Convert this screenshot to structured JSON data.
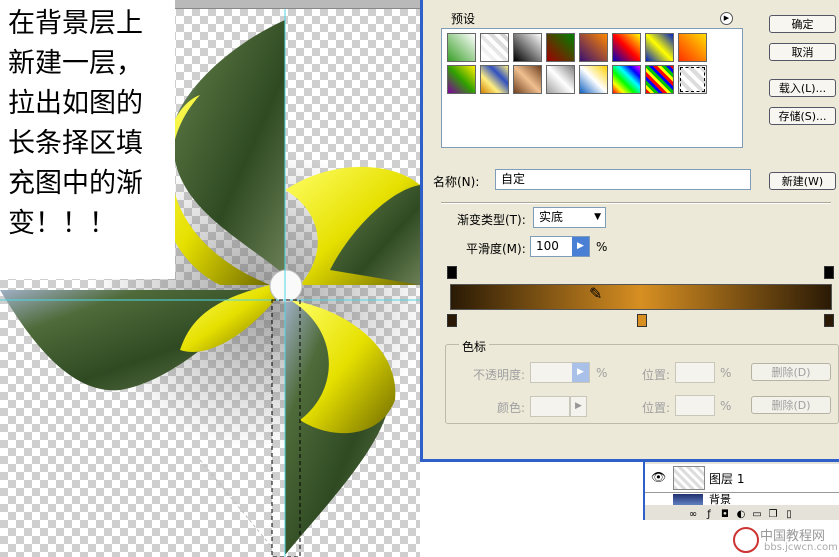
{
  "note": {
    "lines": [
      "在背景层上",
      "新建一层，",
      "拉出如图的",
      "长条择区填",
      "充图中的渐",
      "变！！！"
    ]
  },
  "dialog": {
    "presets_label": "预设",
    "buttons": {
      "ok": "确定",
      "cancel": "取消",
      "load": "载入(L)...",
      "save": "存储(S)...",
      "new": "新建(W)"
    },
    "name_label": "名称(N):",
    "name_value": "自定",
    "gradient_type_label": "渐变类型(T):",
    "gradient_type_value": "实底",
    "smoothness_label": "平滑度(M):",
    "smoothness_value": "100",
    "percent": "%",
    "stops_group_label": "色标",
    "opacity_label": "不透明度:",
    "color_label": "颜色:",
    "location_label": "位置:",
    "delete_label": "删除(D)",
    "gradient_colors": [
      "#2a1a05",
      "#d78f22",
      "#2a1a05"
    ]
  },
  "layers": {
    "layer1_name": "图层 1",
    "layer2_name": "背景"
  },
  "watermark": {
    "title": "中国教程网",
    "url": "bbs.jcwcn.com"
  }
}
